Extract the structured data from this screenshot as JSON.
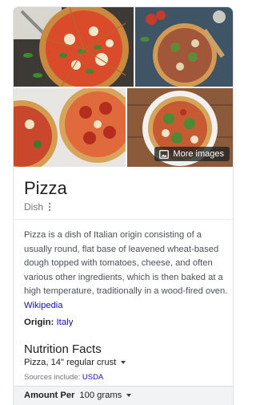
{
  "images": {
    "more_images_label": "More images"
  },
  "entity": {
    "title": "Pizza",
    "type": "Dish"
  },
  "description": {
    "text": "Pizza is a dish of Italian origin consisting of a usually round, flat base of leavened wheat-based dough topped with tomatoes, cheese, and often various other ingredients, which is then baked at a high temperature, traditionally in a wood-fired oven.",
    "source_link": "Wikipedia"
  },
  "origin": {
    "label": "Origin:",
    "value": "Italy"
  },
  "nutrition": {
    "title": "Nutrition Facts",
    "serving": "Pizza, 14\" regular crust",
    "sources_prefix": "Sources include:",
    "sources_link": "USDA",
    "amount_per_label": "Amount Per",
    "amount_per_value": "100 grams"
  },
  "colors": {
    "link": "#1a0dab",
    "title": "#202124",
    "muted": "#70757a"
  }
}
